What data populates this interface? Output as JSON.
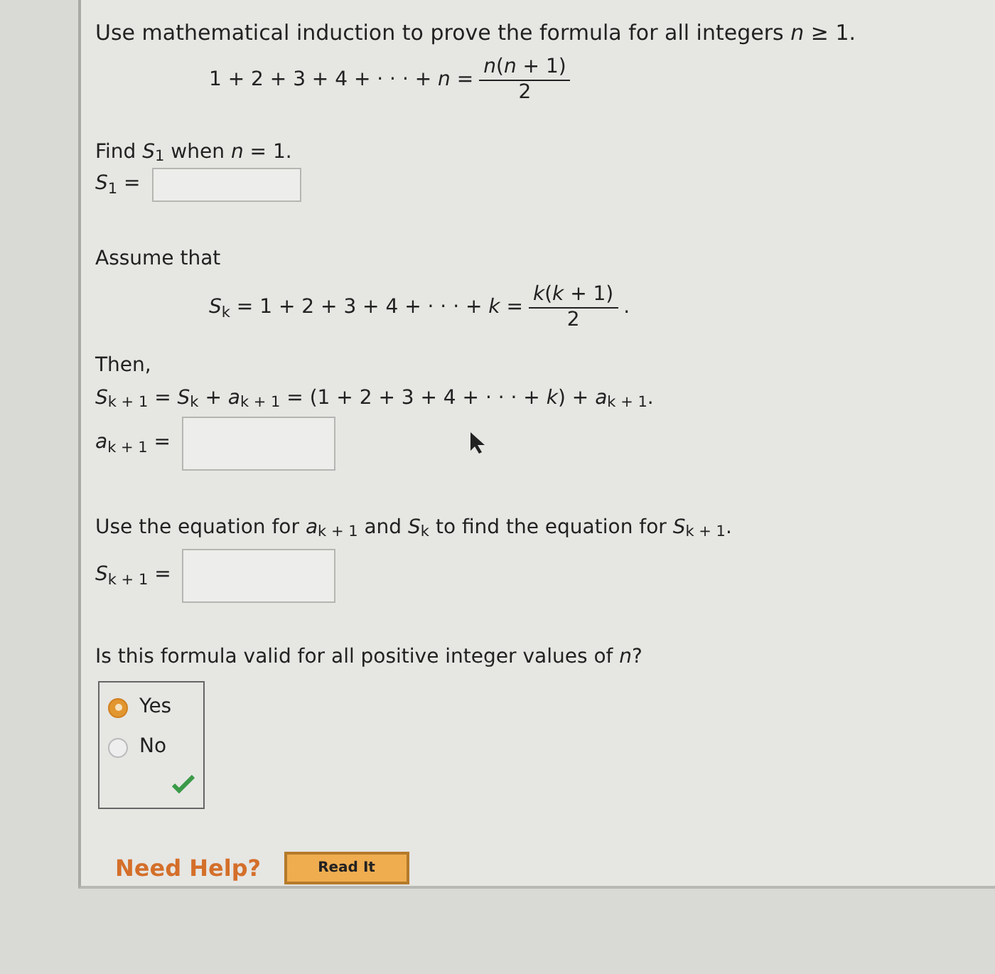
{
  "intro": "Use mathematical induction to prove the formula for all integers *n* ≥ 1.",
  "formula": {
    "lhs": "1 + 2 + 3 + 4 + · · · + *n* =",
    "numerator": "*n*(*n* + 1)",
    "denominator": "2"
  },
  "base_case": {
    "prompt": "Find *S*$_{1}$ when *n* = 1.",
    "label": "*S*$_{1}$ ="
  },
  "assumption": {
    "heading": "Assume that",
    "lhs": "*S*$_{k}$ = 1 + 2 + 3 + 4 + · · · + *k* =",
    "numerator": "*k*(*k* + 1)",
    "denominator": "2",
    "suffix": "."
  },
  "step": {
    "heading": "Then,",
    "equation": "*S*$_{k + 1}$ = *S*$_{k}$ + *a*$_{k + 1}$ = (1 + 2 + 3 + 4 + · · · + *k*) + *a*$_{k + 1}$.",
    "label": "*a*$_{k + 1}$ ="
  },
  "next": {
    "prompt": "Use the equation for *a*$_{k + 1}$ and *S*$_{k}$ to find the equation for *S*$_{k + 1}$.",
    "label": "*S*$_{k + 1}$ ="
  },
  "question": {
    "prompt": "Is this formula valid for all positive integer values of *n*?",
    "options": [
      {
        "label": "Yes",
        "selected": true
      },
      {
        "label": "No",
        "selected": false
      }
    ],
    "correct": true
  },
  "help": {
    "label": "Need Help?",
    "button": "Read It"
  }
}
